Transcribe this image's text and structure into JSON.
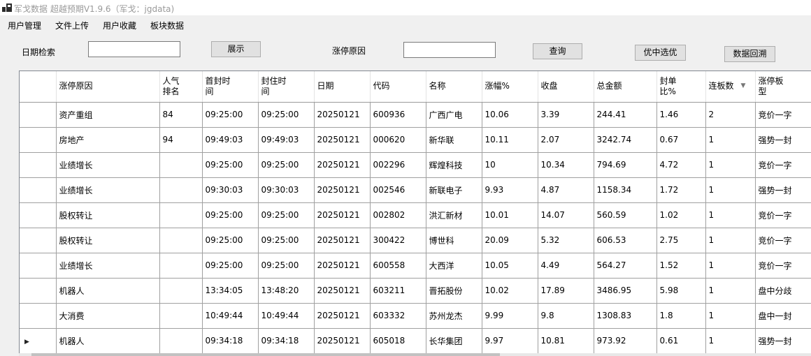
{
  "window": {
    "title": "军戈数据 超越预期V1.9.6（军戈：jgdata)",
    "icon": "app-grid-icon"
  },
  "menu": {
    "items": [
      "用户管理",
      "文件上传",
      "用户收藏",
      "板块数据"
    ]
  },
  "toolbar": {
    "date_label": "日期检索",
    "date_value": "",
    "show_button": "展示",
    "reason_label": "涨停原因",
    "reason_value": "",
    "query_button": "查询",
    "select_button": "优中选优",
    "backtrack_button": "数据回溯"
  },
  "grid": {
    "columns": [
      {
        "key": "reason",
        "label": "涨停原因"
      },
      {
        "key": "popularity",
        "label": "人气排名"
      },
      {
        "key": "first_seal",
        "label": "首封时间"
      },
      {
        "key": "seal",
        "label": "封住时间"
      },
      {
        "key": "date",
        "label": "日期"
      },
      {
        "key": "code",
        "label": "代码"
      },
      {
        "key": "name",
        "label": "名称"
      },
      {
        "key": "pct",
        "label": "涨幅%"
      },
      {
        "key": "close",
        "label": "收盘"
      },
      {
        "key": "amount",
        "label": "总金额"
      },
      {
        "key": "seal_ratio",
        "label": "封单比%"
      },
      {
        "key": "streak",
        "label": "连板数",
        "sort_icon": "sort-down-icon"
      },
      {
        "key": "board",
        "label": "涨停板型"
      }
    ],
    "current_row_marker": "▶",
    "current_row_index": 9,
    "rows": [
      [
        "资产重组",
        "84",
        "09:25:00",
        "09:25:00",
        "20250121",
        "600936",
        "广西广电",
        "10.06",
        "3.39",
        "244.41",
        "1.46",
        "2",
        "竞价一字"
      ],
      [
        "房地产",
        "94",
        "09:49:03",
        "09:49:03",
        "20250121",
        "000620",
        "新华联",
        "10.11",
        "2.07",
        "3242.74",
        "0.67",
        "1",
        "强势一封"
      ],
      [
        "业绩增长",
        "",
        "09:25:00",
        "09:25:00",
        "20250121",
        "002296",
        "辉煌科技",
        "10",
        "10.34",
        "794.69",
        "4.72",
        "1",
        "竞价一字"
      ],
      [
        "业绩增长",
        "",
        "09:30:03",
        "09:30:03",
        "20250121",
        "002546",
        "新联电子",
        "9.93",
        "4.87",
        "1158.34",
        "1.72",
        "1",
        "强势一封"
      ],
      [
        "股权转让",
        "",
        "09:25:00",
        "09:25:00",
        "20250121",
        "002802",
        "洪汇新材",
        "10.01",
        "14.07",
        "560.59",
        "1.02",
        "1",
        "竞价一字"
      ],
      [
        "股权转让",
        "",
        "09:25:00",
        "09:25:00",
        "20250121",
        "300422",
        "博世科",
        "20.09",
        "5.32",
        "606.53",
        "2.75",
        "1",
        "竞价一字"
      ],
      [
        "业绩增长",
        "",
        "09:25:00",
        "09:25:00",
        "20250121",
        "600558",
        "大西洋",
        "10.05",
        "4.49",
        "564.27",
        "1.52",
        "1",
        "竞价一字"
      ],
      [
        "机器人",
        "",
        "13:34:05",
        "13:48:20",
        "20250121",
        "603211",
        "晋拓股份",
        "10.02",
        "17.89",
        "3486.95",
        "5.98",
        "1",
        "盘中分歧"
      ],
      [
        "大消费",
        "",
        "10:49:44",
        "10:49:44",
        "20250121",
        "603332",
        "苏州龙杰",
        "9.99",
        "9.8",
        "1308.83",
        "1.8",
        "1",
        "盘中一封"
      ],
      [
        "机器人",
        "",
        "09:34:18",
        "09:34:18",
        "20250121",
        "605018",
        "长华集团",
        "9.97",
        "10.81",
        "973.92",
        "0.61",
        "1",
        "强势一封"
      ]
    ]
  }
}
